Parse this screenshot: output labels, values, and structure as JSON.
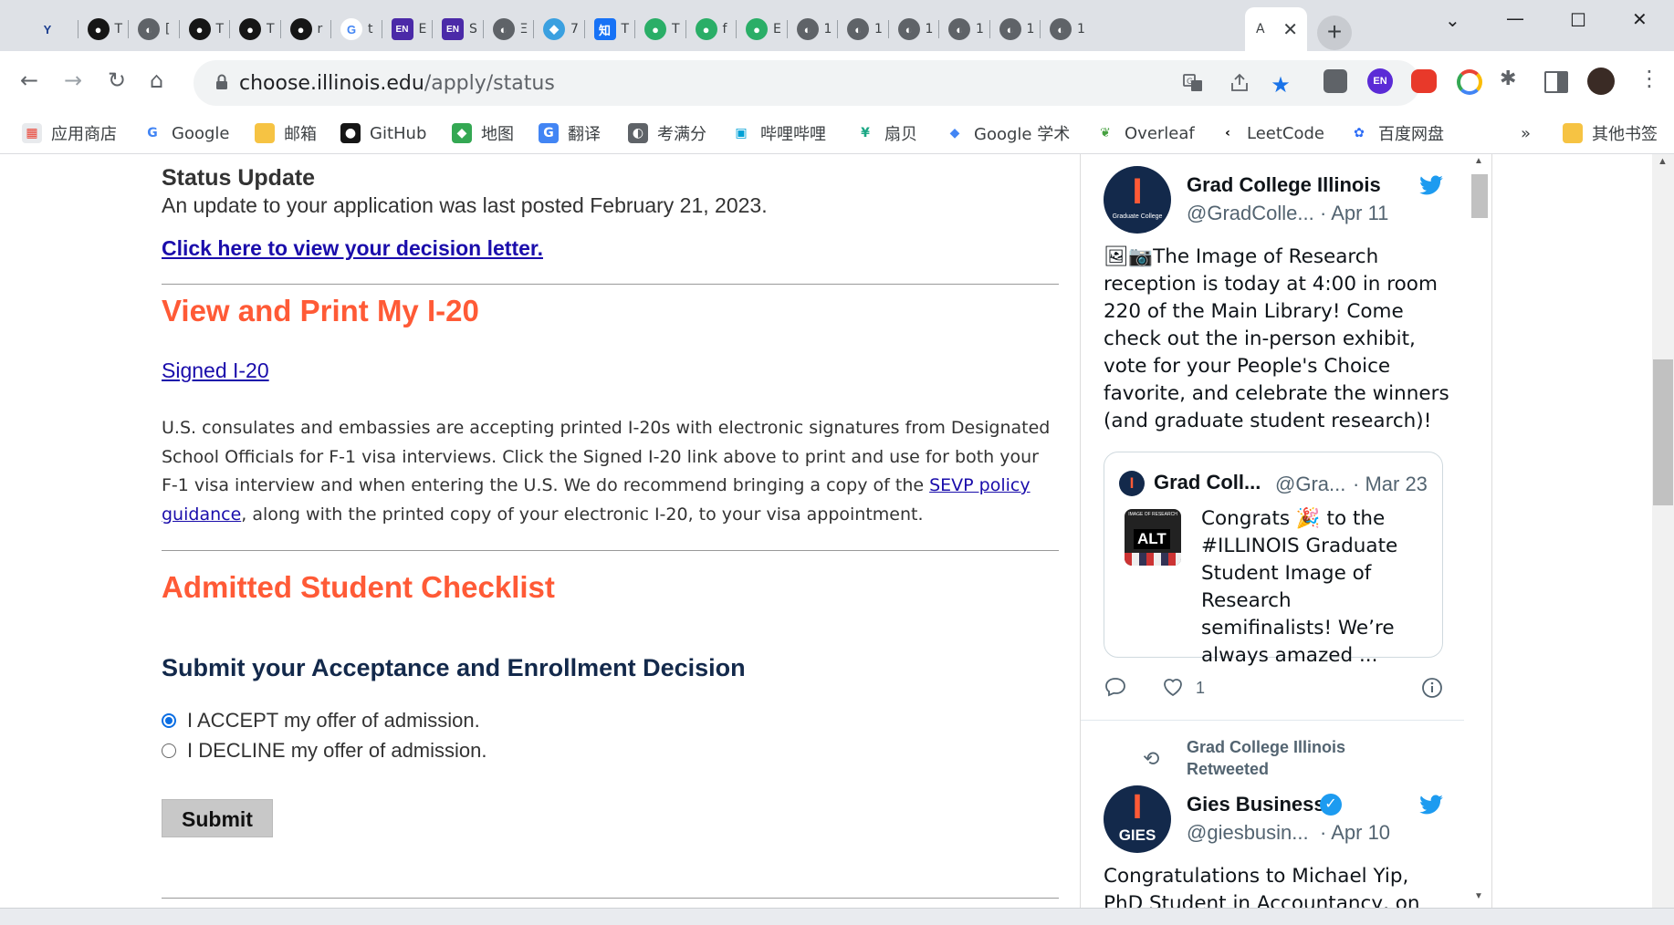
{
  "tabs": {
    "items": [
      {
        "icon": "app-logo-icon",
        "title": ""
      },
      {
        "icon": "github-icon",
        "title": "T"
      },
      {
        "icon": "globe-icon",
        "title": "["
      },
      {
        "icon": "github-icon",
        "title": "T"
      },
      {
        "icon": "github-icon",
        "title": "T"
      },
      {
        "icon": "github-icon",
        "title": "r"
      },
      {
        "icon": "google-icon",
        "title": "t"
      },
      {
        "icon": "en-icon",
        "title": "E"
      },
      {
        "icon": "en-icon",
        "title": "S"
      },
      {
        "icon": "globe-icon",
        "title": "Ξ"
      },
      {
        "icon": "layers-icon",
        "title": "7"
      },
      {
        "icon": "zhi-icon",
        "title": "T"
      },
      {
        "icon": "wechat-icon",
        "title": "T"
      },
      {
        "icon": "wechat-icon",
        "title": "f"
      },
      {
        "icon": "wechat-icon",
        "title": "E"
      },
      {
        "icon": "globe-icon",
        "title": "1"
      },
      {
        "icon": "globe-icon",
        "title": "1"
      },
      {
        "icon": "globe-icon",
        "title": "1"
      },
      {
        "icon": "globe-icon",
        "title": "1"
      },
      {
        "icon": "globe-icon",
        "title": "1"
      },
      {
        "icon": "globe-icon",
        "title": "1"
      }
    ],
    "active_title": "A"
  },
  "toolbar": {
    "url_host": "choose.illinois.edu",
    "url_path": "/apply/status"
  },
  "bookmarks": [
    {
      "label": "应用商店",
      "icon": "apps-icon"
    },
    {
      "label": "Google",
      "icon": "google-icon"
    },
    {
      "label": "邮箱",
      "icon": "folder-icon"
    },
    {
      "label": "GitHub",
      "icon": "github-icon"
    },
    {
      "label": "地图",
      "icon": "maps-icon"
    },
    {
      "label": "翻译",
      "icon": "translate-icon"
    },
    {
      "label": "考满分",
      "icon": "globe-icon"
    },
    {
      "label": "哔哩哔哩",
      "icon": "bilibili-icon"
    },
    {
      "label": "扇贝",
      "icon": "shanbay-icon"
    },
    {
      "label": "Google 学术",
      "icon": "scholar-icon"
    },
    {
      "label": "Overleaf",
      "icon": "overleaf-icon"
    },
    {
      "label": "LeetCode",
      "icon": "leetcode-icon"
    },
    {
      "label": "百度网盘",
      "icon": "baidu-icon"
    }
  ],
  "bookmarks_more": "»",
  "bookmarks_other": "其他书签",
  "page": {
    "status_heading": "Status Update",
    "status_text": "An update to your application was last posted February 21, 2023.",
    "decision_link": "Click here to view your decision letter.",
    "i20_heading": "View and Print My I-20",
    "i20_link": "Signed I-20",
    "para_before": "U.S. consulates and embassies are accepting printed I-20s with electronic signatures from Designated School Officials for F-1 visa interviews. Click the Signed I-20 link above to print and use for both your F-1 visa interview and when entering the U.S. We do recommend bringing a copy of the ",
    "para_link": "SEVP policy guidance",
    "para_after": ", along with the printed copy of your electronic I-20, to your visa appointment.",
    "checklist_heading": "Admitted Student Checklist",
    "decision_heading": "Submit your Acceptance and Enrollment Decision",
    "accept_label": "I ACCEPT my offer of admission.",
    "decline_label": "I DECLINE my offer of admission.",
    "selected": "accept",
    "submit_label": "Submit"
  },
  "twitter": {
    "tweet1": {
      "name": "Grad College Illinois",
      "handle": "@GradColle...",
      "date": "· Apr 11",
      "text": "🖼📷The Image of Research reception is today at 4:00 in room 220 of the Main Library! Come check out the in-person exhibit, vote for your People's Choice favorite, and celebrate the winners (and graduate student research)!",
      "avatar_sub": "Graduate College",
      "avatar_letter": "I",
      "quote": {
        "name": "Grad Coll...",
        "handle": "@Gra...",
        "date": "· Mar 23",
        "thumb_top": "IMAGE OF RESEARCH",
        "thumb_label": "ALT",
        "text": "Congrats 🎉 to the #ILLINOIS Graduate Student Image of Research semifinalists! We’re always amazed ..."
      },
      "likes": "1"
    },
    "retweet_label_1": "Grad College Illinois",
    "retweet_label_2": "Retweeted",
    "tweet2": {
      "name": "Gies Business",
      "handle": "@giesbusin...",
      "date": "· Apr 10",
      "avatar_letter": "I",
      "avatar_sub": "GIES",
      "text": "Congratulations to Michael Yip, PhD Student in Accountancy, on receiving"
    }
  },
  "colors": {
    "orange": "#ff5a36",
    "navy": "#13294b",
    "link": "#1a0dab",
    "twitter_blue": "#1d9bf0"
  }
}
